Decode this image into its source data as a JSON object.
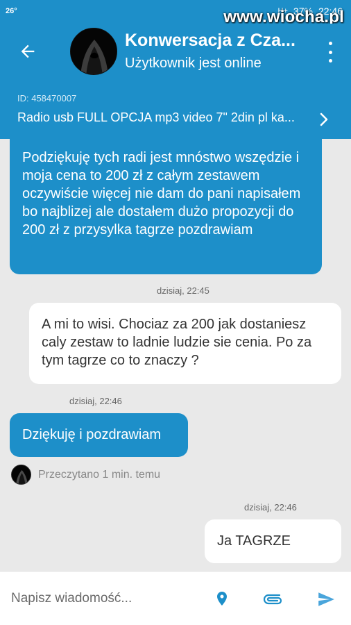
{
  "status_bar": {
    "temperature": "26°",
    "network": "H+",
    "battery": "37%",
    "time": "22:46",
    "watermark": "www.wiocha.pl"
  },
  "header": {
    "title": "Konwersacja z Cza...",
    "subtitle": "Użytkownik jest online",
    "back_icon": "arrow-left-icon",
    "menu_icon": "more-vert-icon"
  },
  "listing": {
    "id": "ID: 458470007",
    "title": "Radio usb FULL OPCJA mp3 video 7\" 2din pl ka...",
    "chevron_icon": "chevron-right-icon"
  },
  "messages": [
    {
      "sender": "other",
      "text": "Podziękuję tych radi jest mnóstwo wszędzie i moja cena to 200 zł z całym zestawem oczywiście więcej nie dam do pani napisałem bo najblizej ale dostałem dużo propozycji do 200 zł z przysylka tagrze pozdrawiam"
    },
    {
      "sender": "me",
      "timestamp": "dzisiaj, 22:45",
      "text": "A mi to wisi. Chociaz za 200 jak dostaniesz caly zestaw to ladnie ludzie sie cenia. Po za tym tagrze co to znaczy ?"
    },
    {
      "sender": "other",
      "timestamp": "dzisiaj, 22:46",
      "text": "Dziękuję i pozdrawiam"
    },
    {
      "sender": "me",
      "timestamp": "dzisiaj, 22:46",
      "text": "Ja TAGRZE"
    }
  ],
  "read_receipt": "Przeczytano 1 min. temu",
  "composer": {
    "placeholder": "Napisz wiadomość...",
    "location_icon": "location-pin-icon",
    "attach_icon": "paperclip-icon",
    "send_icon": "send-icon"
  },
  "colors": {
    "primary": "#1d8fc9",
    "background": "#e9e9e9",
    "bubble_me": "#ffffff"
  }
}
